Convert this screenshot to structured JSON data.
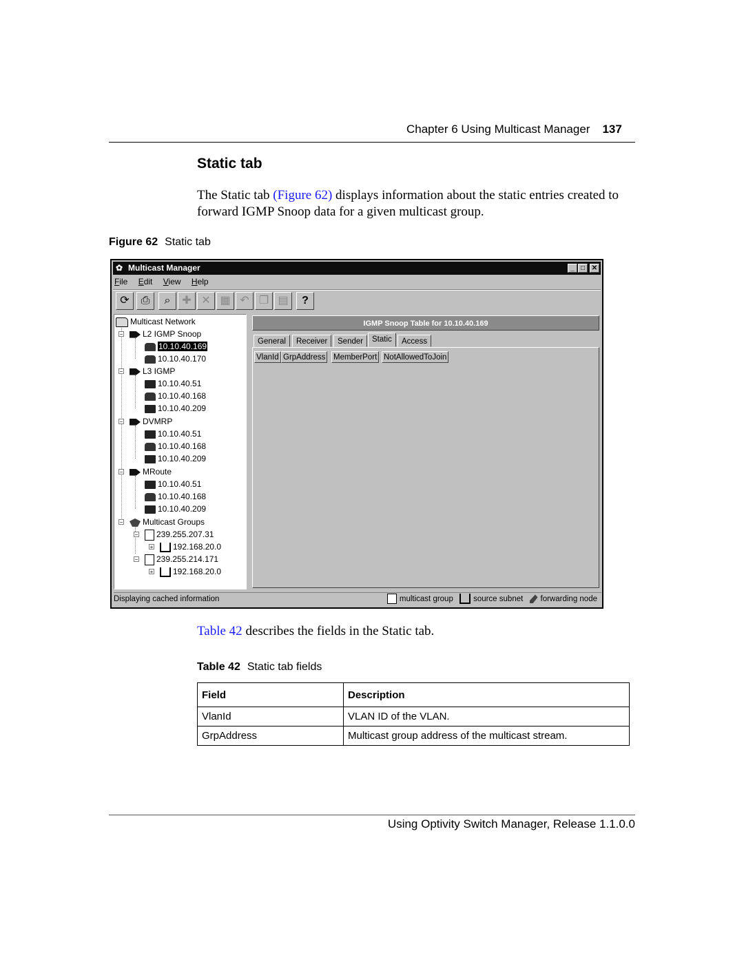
{
  "header": {
    "chapter": "Chapter 6  Using Multicast Manager",
    "page_number": "137"
  },
  "section_title": "Static tab",
  "intro": {
    "before_link": "The Static tab ",
    "link": "(Figure 62)",
    "after_link": " displays information about the static entries created to forward IGMP Snoop data for a given multicast group."
  },
  "figure": {
    "label": "Figure 62",
    "title": "Static tab"
  },
  "window": {
    "title": "Multicast Manager",
    "controls": {
      "minimize": "_",
      "maximize": "□",
      "close": "✕"
    },
    "menu": [
      {
        "label": "File",
        "mnemonic": "F",
        "rest": "ile"
      },
      {
        "label": "Edit",
        "mnemonic": "E",
        "rest": "dit"
      },
      {
        "label": "View",
        "mnemonic": "V",
        "rest": "iew"
      },
      {
        "label": "Help",
        "mnemonic": "H",
        "rest": "elp"
      }
    ],
    "toolbar": [
      {
        "icon": "refresh-icon",
        "glyph": "⟳",
        "enabled": true
      },
      {
        "icon": "print-icon",
        "glyph": "⎙",
        "enabled": true
      },
      {
        "icon": "find-icon",
        "glyph": "⌕",
        "enabled": true
      },
      {
        "icon": "add-icon",
        "glyph": "✚",
        "enabled": false
      },
      {
        "icon": "delete-icon",
        "glyph": "✕",
        "enabled": false
      },
      {
        "icon": "properties-icon",
        "glyph": "▦",
        "enabled": false
      },
      {
        "icon": "undo-icon",
        "glyph": "↶",
        "enabled": false
      },
      {
        "icon": "copy-icon",
        "glyph": "❐",
        "enabled": false
      },
      {
        "icon": "paste-icon",
        "glyph": "▤",
        "enabled": false
      },
      {
        "icon": "help-icon",
        "glyph": "?",
        "enabled": true
      }
    ],
    "tree": [
      {
        "label": "Multicast Network",
        "level": 0,
        "icon": "folder"
      },
      {
        "label": "L2 IGMP Snoop",
        "level": 1,
        "icon": "arrow"
      },
      {
        "label": "10.10.40.169",
        "level": 2,
        "icon": "switch",
        "selected": true
      },
      {
        "label": "10.10.40.170",
        "level": 2,
        "icon": "switch"
      },
      {
        "label": "L3 IGMP",
        "level": 1,
        "icon": "arrow"
      },
      {
        "label": "10.10.40.51",
        "level": 2,
        "icon": "switch2"
      },
      {
        "label": "10.10.40.168",
        "level": 2,
        "icon": "switch"
      },
      {
        "label": "10.10.40.209",
        "level": 2,
        "icon": "switch2"
      },
      {
        "label": "DVMRP",
        "level": 1,
        "icon": "arrow"
      },
      {
        "label": "10.10.40.51",
        "level": 2,
        "icon": "switch2"
      },
      {
        "label": "10.10.40.168",
        "level": 2,
        "icon": "switch"
      },
      {
        "label": "10.10.40.209",
        "level": 2,
        "icon": "switch2"
      },
      {
        "label": "MRoute",
        "level": 1,
        "icon": "arrow"
      },
      {
        "label": "10.10.40.51",
        "level": 2,
        "icon": "switch2"
      },
      {
        "label": "10.10.40.168",
        "level": 2,
        "icon": "switch"
      },
      {
        "label": "10.10.40.209",
        "level": 2,
        "icon": "switch2"
      },
      {
        "label": "Multicast Groups",
        "level": 1,
        "icon": "group"
      },
      {
        "label": "239.255.207.31",
        "level": 2,
        "icon": "doc"
      },
      {
        "label": "192.168.20.0",
        "level": 3,
        "icon": "subnet"
      },
      {
        "label": "239.255.214.171",
        "level": 2,
        "icon": "doc"
      },
      {
        "label": "192.168.20.0",
        "level": 3,
        "icon": "subnet"
      }
    ],
    "panel_title": "IGMP Snoop Table for 10.10.40.169",
    "tabs": [
      {
        "label": "General",
        "active": false
      },
      {
        "label": "Receiver",
        "active": false
      },
      {
        "label": "Sender",
        "active": false
      },
      {
        "label": "Static",
        "active": true
      },
      {
        "label": "Access",
        "active": false
      }
    ],
    "columns": [
      "VlanId",
      "GrpAddress",
      "MemberPort",
      "NotAllowedToJoin"
    ],
    "status": "Displaying cached information",
    "legend": [
      "multicast group",
      "source subnet",
      "forwarding node"
    ]
  },
  "table_intro": {
    "link": "Table 42",
    "text": " describes the fields in the Static tab."
  },
  "table": {
    "label": "Table 42",
    "title": "Static tab fields",
    "headers": [
      "Field",
      "Description"
    ],
    "rows": [
      [
        "VlanId",
        "VLAN ID of the VLAN."
      ],
      [
        "GrpAddress",
        "Multicast group address of the multicast stream."
      ]
    ]
  },
  "footer": "Using Optivity Switch Manager, Release 1.1.0.0"
}
